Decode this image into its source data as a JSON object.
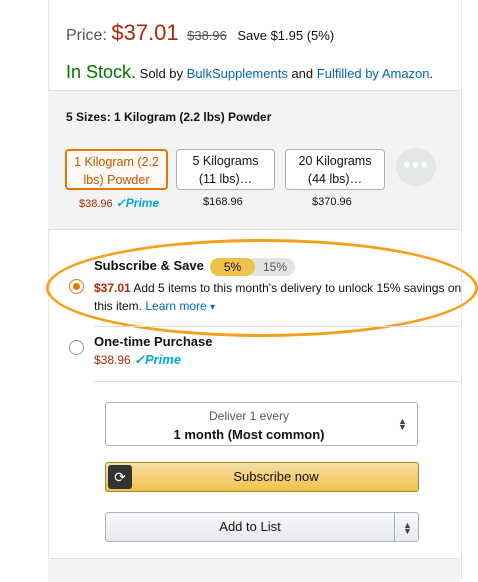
{
  "price": {
    "label": "Price:",
    "current": "$37.01",
    "list": "$38.96",
    "save": "Save $1.95 (5%)"
  },
  "stock": {
    "status": "In Stock.",
    "sold_by_prefix": "Sold by",
    "seller": "BulkSupplements",
    "and": "and",
    "fulfilled": "Fulfilled by Amazon",
    "end": "."
  },
  "sizes": {
    "title": "5 Sizes: 1 Kilogram (2.2 lbs) Powder",
    "options": [
      {
        "line1": "1 Kilogram (2.2",
        "line2": "lbs) Powder",
        "price": "$38.96",
        "prime": "✓Prime",
        "selected": true
      },
      {
        "line1": "5 Kilograms",
        "line2": "(11 lbs)…",
        "price": "$168.96"
      },
      {
        "line1": "20 Kilograms",
        "line2": "(44 lbs)…",
        "price": "$370.96"
      }
    ],
    "more": "•••"
  },
  "subscribe": {
    "title": "Subscribe & Save",
    "pill_selected": "5%",
    "pill_other": "15%",
    "price": "$37.01",
    "desc": "Add 5 items to this month's delivery to unlock 15% savings on this item.",
    "learn_more": "Learn more",
    "caret": "▾"
  },
  "one_time": {
    "title": "One-time Purchase",
    "price": "$38.96",
    "prime": "✓Prime"
  },
  "deliver": {
    "label": "Deliver 1 every",
    "value": "1 month (Most common)"
  },
  "buttons": {
    "subscribe": "Subscribe now",
    "add_to_list": "Add to List"
  },
  "colors": {
    "accent": "#e77600",
    "price_red": "#b12704",
    "stock_green": "#007600",
    "button_yellow": "#f0c14b",
    "link_blue": "#0066c0"
  }
}
